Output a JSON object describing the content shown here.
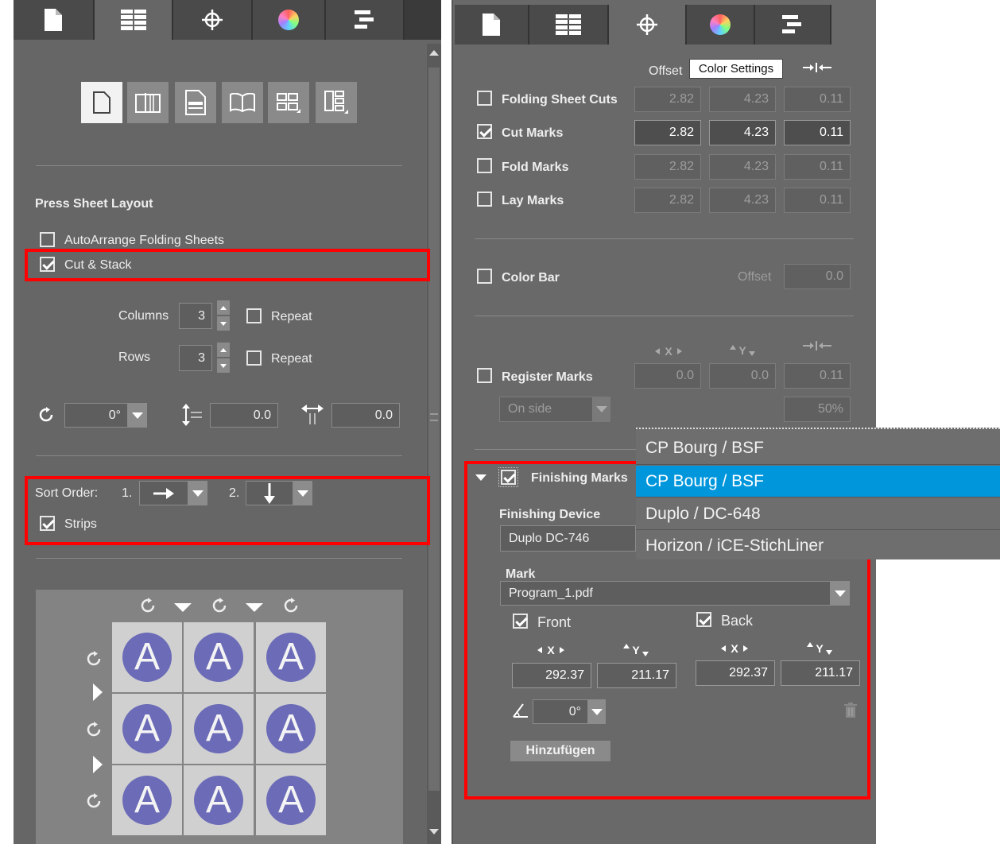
{
  "left_panel": {
    "section_title": "Press Sheet Layout",
    "auto_arrange_label": "AutoArrange Folding Sheets",
    "cut_stack_label": "Cut & Stack",
    "columns_label": "Columns",
    "columns_value": "3",
    "rows_label": "Rows",
    "rows_value": "3",
    "repeat_label": "Repeat",
    "rotation_value": "0°",
    "spacing_v_value": "0.0",
    "spacing_h_value": "0.0",
    "sort_order_label": "Sort Order:",
    "sort_1": "1.",
    "sort_2": "2.",
    "strips_label": "Strips",
    "grid_letter": "A"
  },
  "right_panel": {
    "offset_label": "Offset",
    "tooltip": "Color Settings",
    "marks": [
      {
        "label": "Folding Sheet Cuts",
        "values": [
          "2.82",
          "4.23",
          "0.11"
        ],
        "checked": false
      },
      {
        "label": "Cut Marks",
        "values": [
          "2.82",
          "4.23",
          "0.11"
        ],
        "checked": true
      },
      {
        "label": "Fold Marks",
        "values": [
          "2.82",
          "4.23",
          "0.11"
        ],
        "checked": false
      },
      {
        "label": "Lay Marks",
        "values": [
          "2.82",
          "4.23",
          "0.11"
        ],
        "checked": false
      }
    ],
    "color_bar_label": "Color Bar",
    "color_bar_offset_label": "Offset",
    "color_bar_offset": "0.0",
    "x_label": "X",
    "y_label": "Y",
    "register_label": "Register Marks",
    "register_values": [
      "0.0",
      "0.0",
      "0.11"
    ],
    "register_position": "On side",
    "register_percent": "50%",
    "finishing_label": "Finishing Marks",
    "finishing_device_label": "Finishing Device",
    "finishing_device_value": "Duplo DC-746",
    "device_options": [
      "CP Bourg / BSF",
      "CP Bourg / BSF",
      "Duplo / DC-648",
      "Horizon / iCE-StichLiner"
    ],
    "mark_label": "Mark",
    "mark_value": "Program_1.pdf",
    "front_label": "Front",
    "back_label": "Back",
    "front_x": "292.37",
    "front_y": "211.17",
    "back_x": "292.37",
    "back_y": "211.17",
    "angle_value": "0°",
    "add_button": "Hinzufügen"
  },
  "colors": {
    "panel": "#666666",
    "highlight": "#ff0000",
    "selection": "#0096dc",
    "circle": "#6b6bb8"
  }
}
